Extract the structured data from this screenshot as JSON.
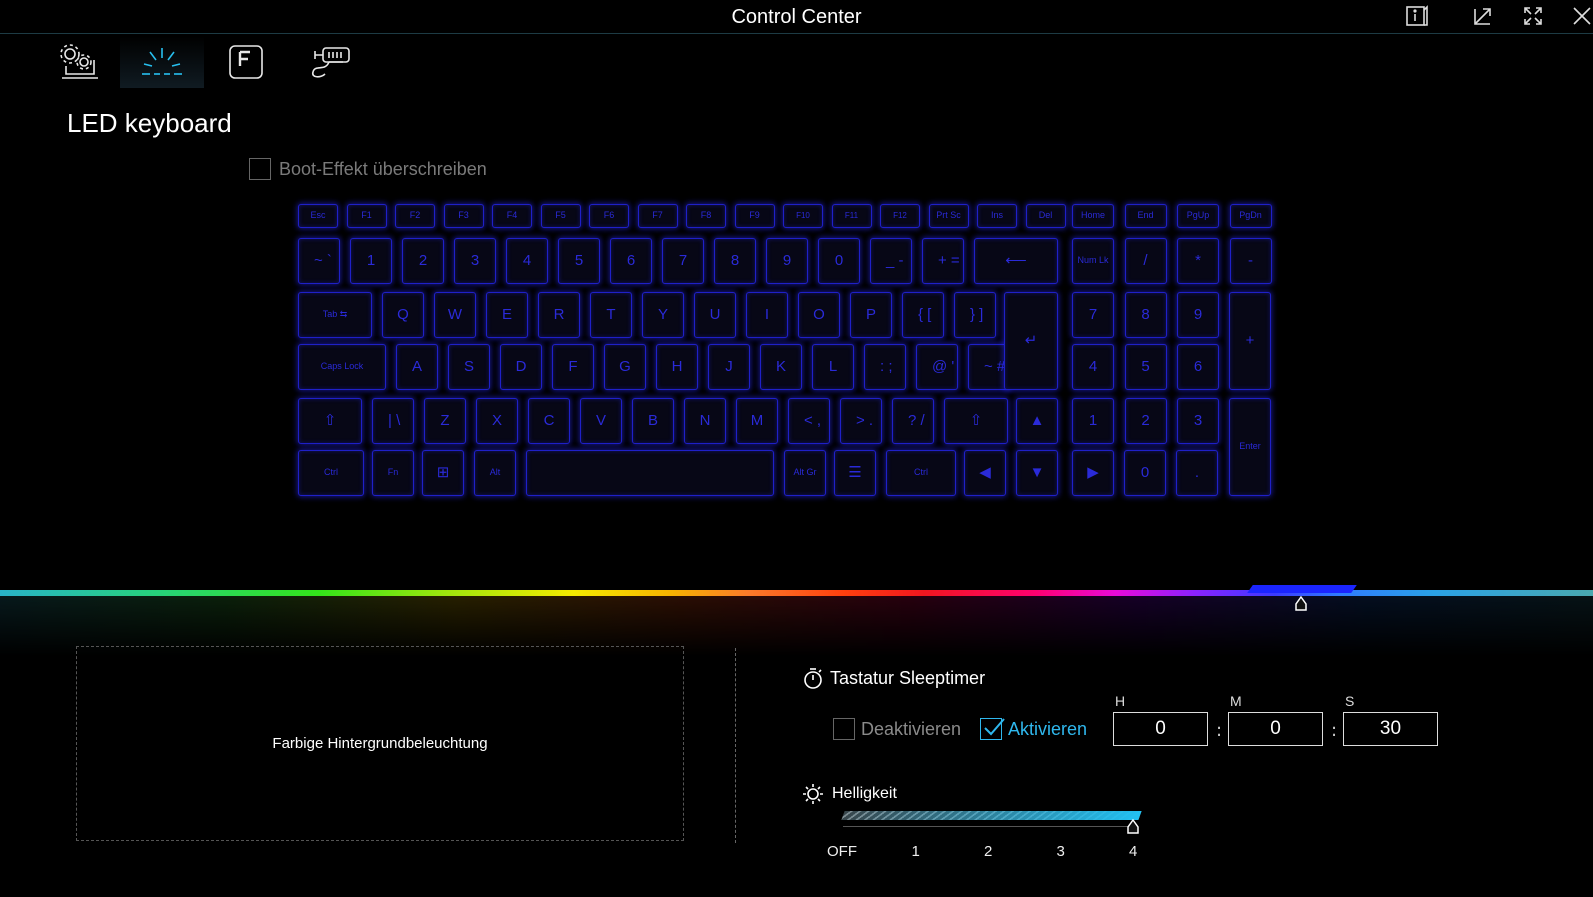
{
  "window": {
    "title": "Control Center"
  },
  "page": {
    "title": "LED keyboard",
    "boot_effect_label": "Boot-Effekt überschreiben"
  },
  "keyboard": {
    "rows": [
      [
        "Esc",
        "F1",
        "F2",
        "F3",
        "F4",
        "F5",
        "F6",
        "F7",
        "F8",
        "F9",
        "F10",
        "F11",
        "F12",
        "Prt Sc",
        "Ins",
        "Del",
        "Home",
        "End",
        "PgUp",
        "PgDn"
      ],
      [
        "~ `",
        "1",
        "2",
        "3",
        "4",
        "5",
        "6",
        "7",
        "8",
        "9",
        "0",
        "_ -",
        "+ =",
        "⟵",
        "Num Lk",
        "/",
        "*",
        "-"
      ],
      [
        "Tab ⇆",
        "Q",
        "W",
        "E",
        "R",
        "T",
        "Y",
        "U",
        "I",
        "O",
        "P",
        "{ [",
        "} ]",
        "7",
        "8",
        "9",
        "+"
      ],
      [
        "Caps Lock",
        "A",
        "S",
        "D",
        "F",
        "G",
        "H",
        "J",
        "K",
        "L",
        ": ;",
        "@ '",
        "~ #",
        "↵",
        "4",
        "5",
        "6"
      ],
      [
        "⇧",
        "| \\",
        "Z",
        "X",
        "C",
        "V",
        "B",
        "N",
        "M",
        "< ,",
        "> .",
        "? /",
        "⇧",
        "▲",
        "1",
        "2",
        "3",
        "Enter"
      ],
      [
        "Ctrl",
        "Fn",
        "⊞",
        "Alt",
        "",
        "Alt Gr",
        "☰",
        "Ctrl",
        "◀",
        "▼",
        "▶",
        "0",
        "."
      ]
    ]
  },
  "backlight": {
    "label": "Farbige Hintergrundbeleuchtung"
  },
  "sleeptimer": {
    "title": "Tastatur Sleeptimer",
    "deactivate_label": "Deaktivieren",
    "activate_label": "Aktivieren",
    "selected": "Aktivieren",
    "h_label": "H",
    "m_label": "M",
    "s_label": "S",
    "hours": "0",
    "minutes": "0",
    "seconds": "30",
    "sep": ":"
  },
  "brightness": {
    "title": "Helligkeit",
    "ticks": [
      "OFF",
      "1",
      "2",
      "3",
      "4"
    ],
    "level": 4,
    "max": 4
  },
  "colors": {
    "accent": "#27c0f0",
    "key_glow": "#1f20c8"
  },
  "icons": {
    "info": "info-icon",
    "restore": "restore-icon",
    "fullscreen": "fullscreen-icon",
    "close": "close-icon",
    "nav": [
      "system-settings-icon",
      "led-keyboard-icon",
      "fn-key-icon",
      "flexikey-icon"
    ]
  }
}
